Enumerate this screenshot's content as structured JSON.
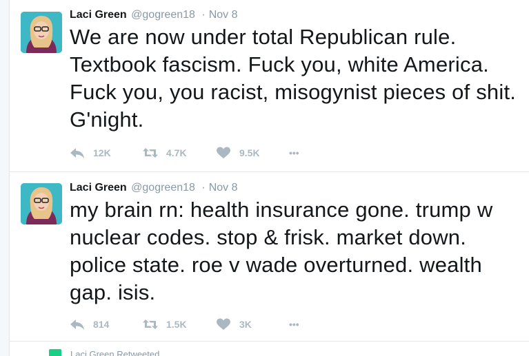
{
  "tweets": [
    {
      "name": "Laci Green",
      "handle": "@gogreen18",
      "separator": "·",
      "time": "Nov 8",
      "text": "We are now under total Republican rule. Textbook fascism. Fuck you, white America. Fuck you, you racist, misogynist pieces of shit. G'night.",
      "reply_count": "12K",
      "retweet_count": "4.7K",
      "like_count": "9.5K",
      "more_label": "•••"
    },
    {
      "name": "Laci Green",
      "handle": "@gogreen18",
      "separator": "·",
      "time": "Nov 8",
      "text": "my brain rn: health insurance gone. trump w nuclear codes. stop & frisk. market down. police state. roe v wade overturned. wealth gap. isis.",
      "reply_count": "814",
      "retweet_count": "1.5K",
      "like_count": "3K",
      "more_label": "•••"
    }
  ],
  "retweet_notice": {
    "text": "Laci Green Retweeted"
  },
  "icons": {
    "reply": "reply-icon",
    "retweet": "retweet-icon",
    "like": "heart-icon",
    "more": "more-icon",
    "retweeted": "retweet-icon"
  },
  "colors": {
    "text": "#14171a",
    "muted": "#8899a6",
    "action": "#aab8c2",
    "divider": "#e1e8ed",
    "retweet_green": "#19cf86",
    "avatar_bg": "#3fb8c6"
  }
}
